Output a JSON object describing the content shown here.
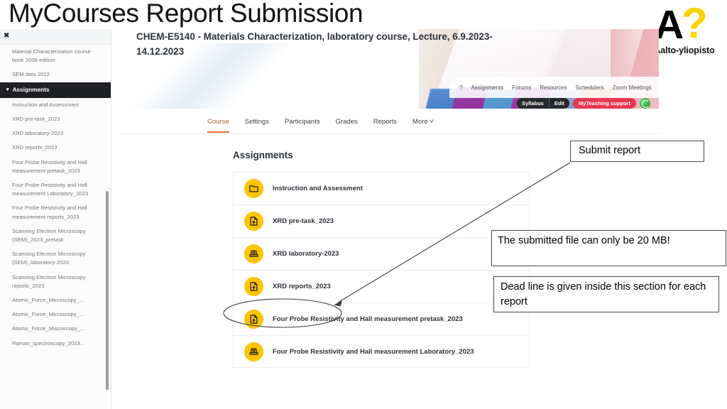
{
  "slide": {
    "title": "MyCourses Report Submission"
  },
  "logo": {
    "mark_letter": "A",
    "mark_question": "?",
    "wordmark": "Aalto-yliopisto"
  },
  "banner": {
    "course_title": "CHEM-E5140 - Materials Characterization, laboratory course, Lecture, 6.9.2023-14.12.2023",
    "pill_nav": [
      "?",
      "Assignments",
      "Forums",
      "Resources",
      "Schedulers",
      "Zoom Meetings"
    ],
    "buttons": {
      "syllabus": "Syllabus",
      "edit": "Edit",
      "support": "MyTeaching support"
    },
    "accent_yellow": "#FFC400",
    "accent_orange": "#F26B3A",
    "support_red": "#E8384F"
  },
  "moodle_tabs": [
    {
      "label": "Course",
      "active": true
    },
    {
      "label": "Settings",
      "active": false
    },
    {
      "label": "Participants",
      "active": false
    },
    {
      "label": "Grades",
      "active": false
    },
    {
      "label": "Reports",
      "active": false
    },
    {
      "label": "More ˅",
      "active": false
    }
  ],
  "main": {
    "heading": "Assignments",
    "rows": [
      {
        "label": "Instruction and Assessment",
        "icon": "folder-icon"
      },
      {
        "label": "XRD pre-task_2023",
        "icon": "assignment-upload-icon"
      },
      {
        "label": "XRD laboratory-2023",
        "icon": "workshop-icon"
      },
      {
        "label": "XRD reports_2023",
        "icon": "assignment-upload-icon",
        "highlighted": true
      },
      {
        "label": "Four Probe Resistivity and Hall measurement pretask_2023",
        "icon": "assignment-upload-icon"
      },
      {
        "label": "Four Probe Resistivity and Hall measurement Laboratory_2023",
        "icon": "workshop-icon"
      }
    ]
  },
  "sidebar": {
    "close_label": "✖",
    "items": [
      {
        "label": "Material Characterization course book 2008 edition",
        "type": "link"
      },
      {
        "label": "SEM data 2022",
        "type": "link"
      },
      {
        "label": "Assignments",
        "type": "section"
      },
      {
        "label": "Instruction and Assessment",
        "type": "link"
      },
      {
        "label": "XRD pre-task_2023",
        "type": "link"
      },
      {
        "label": "XRD laboratory-2023",
        "type": "link"
      },
      {
        "label": "XRD reports_2023",
        "type": "link"
      },
      {
        "label": "Four Probe Resistivity and Hall measurement pretask_2023",
        "type": "link"
      },
      {
        "label": "Four Probe Resistivity and Hall measurement Laboratory_2023",
        "type": "link"
      },
      {
        "label": "Four Probe Resistivity and Hall measurement reports_2023",
        "type": "link"
      },
      {
        "label": "Scanning Electron Microscopy (SEM)_2023_pretask",
        "type": "link"
      },
      {
        "label": "Scanning Electron Microscopy (SEM)_laboratory-2023",
        "type": "link"
      },
      {
        "label": "Scanning Electron Microscopy reports_2023",
        "type": "link"
      },
      {
        "label": "Atomic_Force_Microscopy_...",
        "type": "link"
      },
      {
        "label": "Atomic_Force_Microscopy_...",
        "type": "link"
      },
      {
        "label": "Atomic_Force_Miscoscopy_...",
        "type": "link"
      },
      {
        "label": "Raman_spectroscopy_2023...",
        "type": "link"
      }
    ]
  },
  "annotations": {
    "submit": "Submit report",
    "size_limit": "The submitted file can only be 20 MB!",
    "deadline": "Dead line is given inside this section for each report"
  }
}
